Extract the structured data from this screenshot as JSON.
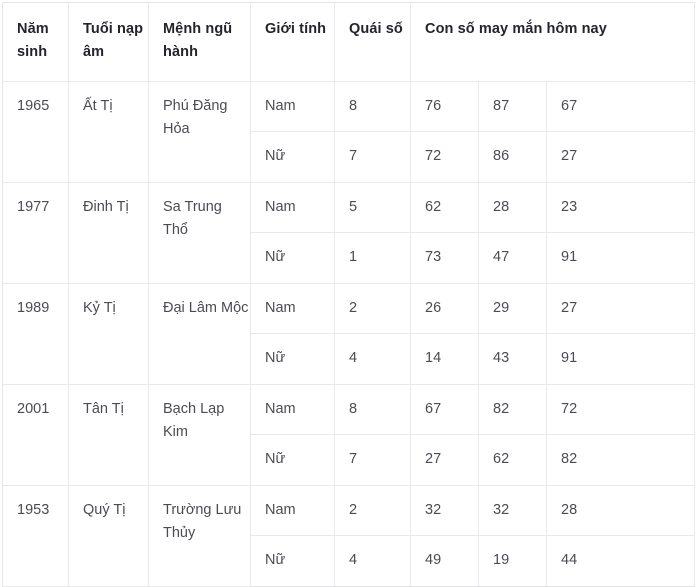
{
  "table": {
    "headers": [
      "Năm sinh",
      "Tuổi nạp âm",
      "Mệnh ngũ hành",
      "Giới tính",
      "Quái số",
      "Con số may mắn hôm nay"
    ],
    "groups": [
      {
        "year": "1965",
        "age_name": "Ất Tị",
        "element": "Phú Đăng Hỏa",
        "rows": [
          {
            "gender": "Nam",
            "quai": "8",
            "n1": "76",
            "n2": "87",
            "n3": "67"
          },
          {
            "gender": "Nữ",
            "quai": "7",
            "n1": "72",
            "n2": "86",
            "n3": "27"
          }
        ]
      },
      {
        "year": "1977",
        "age_name": "Đinh Tị",
        "element": "Sa Trung Thổ",
        "rows": [
          {
            "gender": "Nam",
            "quai": "5",
            "n1": "62",
            "n2": "28",
            "n3": "23"
          },
          {
            "gender": "Nữ",
            "quai": "1",
            "n1": "73",
            "n2": "47",
            "n3": "91"
          }
        ]
      },
      {
        "year": "1989",
        "age_name": "Kỷ Tị",
        "element": "Đại Lâm Mộc",
        "rows": [
          {
            "gender": "Nam",
            "quai": "2",
            "n1": "26",
            "n2": "29",
            "n3": "27"
          },
          {
            "gender": "Nữ",
            "quai": "4",
            "n1": "14",
            "n2": "43",
            "n3": "91"
          }
        ]
      },
      {
        "year": "2001",
        "age_name": "Tân Tị",
        "element": "Bạch Lạp Kim",
        "rows": [
          {
            "gender": "Nam",
            "quai": "8",
            "n1": "67",
            "n2": "82",
            "n3": "72"
          },
          {
            "gender": "Nữ",
            "quai": "7",
            "n1": "27",
            "n2": "62",
            "n3": "82"
          }
        ]
      },
      {
        "year": "1953",
        "age_name": "Quý Tị",
        "element": "Trường Lưu Thủy",
        "rows": [
          {
            "gender": "Nam",
            "quai": "2",
            "n1": "32",
            "n2": "32",
            "n3": "28"
          },
          {
            "gender": "Nữ",
            "quai": "4",
            "n1": "49",
            "n2": "19",
            "n3": "44"
          }
        ]
      }
    ]
  },
  "colors": {
    "header_text": "#24242c",
    "body_text": "#4b4b53",
    "border": "#e9e9eb",
    "background": "#ffffff"
  }
}
